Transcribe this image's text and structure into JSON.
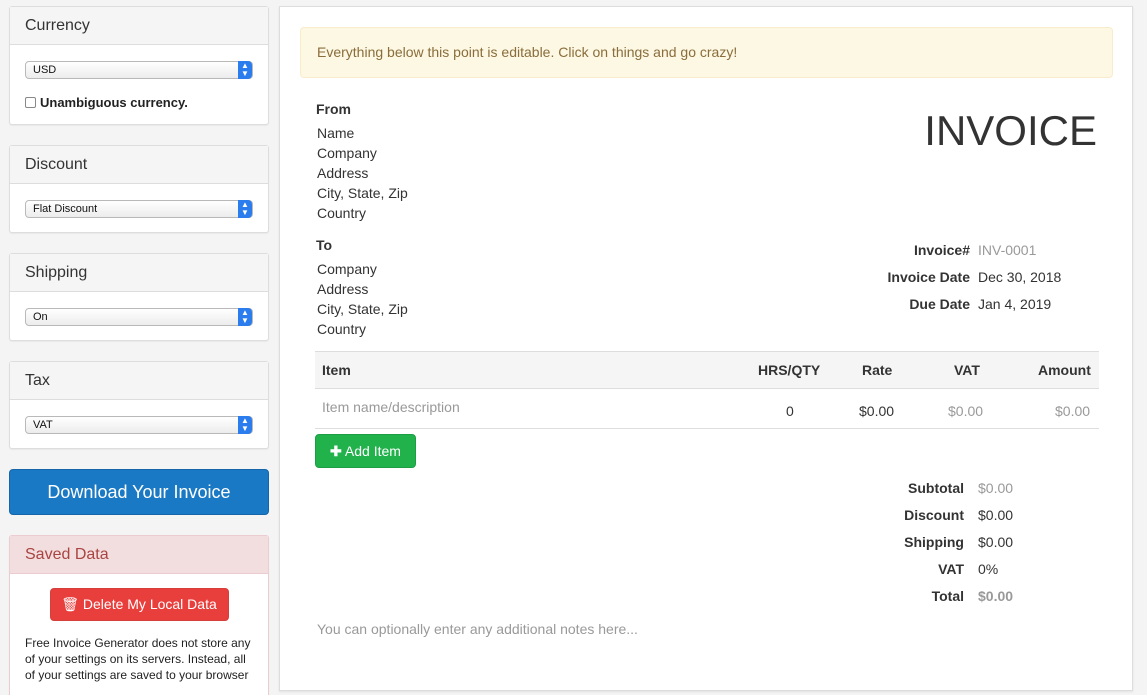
{
  "sidebar": {
    "currency": {
      "title": "Currency",
      "selected": "USD",
      "checkbox_label": "Unambiguous currency."
    },
    "discount": {
      "title": "Discount",
      "selected": "Flat Discount"
    },
    "shipping": {
      "title": "Shipping",
      "selected": "On"
    },
    "tax": {
      "title": "Tax",
      "selected": "VAT"
    },
    "download_label": "Download Your Invoice",
    "saved": {
      "title": "Saved Data",
      "delete_label": "Delete My Local Data",
      "text": "Free Invoice Generator does not store any of your settings on its servers. Instead, all of your settings are saved to your browser"
    }
  },
  "main": {
    "alert": "Everything below this point is editable. Click on things and go crazy!",
    "from": {
      "label": "From",
      "lines": [
        "Name",
        "Company",
        "Address",
        "City, State, Zip",
        "Country"
      ]
    },
    "to": {
      "label": "To",
      "lines": [
        "Company",
        "Address",
        "City, State, Zip",
        "Country"
      ]
    },
    "title": "INVOICE",
    "meta": {
      "invoice_no_label": "Invoice#",
      "invoice_no": "INV-0001",
      "date_label": "Invoice Date",
      "date": "Dec 30, 2018",
      "due_label": "Due Date",
      "due": "Jan 4, 2019"
    },
    "table": {
      "headers": {
        "item": "Item",
        "qty": "HRS/QTY",
        "rate": "Rate",
        "vat": "VAT",
        "amount": "Amount"
      },
      "row": {
        "item_placeholder": "Item name/description",
        "qty": "0",
        "rate": "$0.00",
        "vat": "$0.00",
        "amount": "$0.00"
      }
    },
    "add_item_label": "Add Item",
    "totals": {
      "subtotal_label": "Subtotal",
      "subtotal": "$0.00",
      "discount_label": "Discount",
      "discount": "$0.00",
      "shipping_label": "Shipping",
      "shipping": "$0.00",
      "vat_label": "VAT",
      "vat": "0%",
      "total_label": "Total",
      "total": "$0.00"
    },
    "notes_placeholder": "You can optionally enter any additional notes here..."
  },
  "colors": {
    "download_button": "#1a79c4",
    "delete_button": "#e83e3c",
    "add_button": "#22b24c",
    "alert_bg": "#fcf8e3",
    "alert_text": "#8a6d3b",
    "saved_heading": "#a94442"
  },
  "icons": {
    "add": "plus-icon",
    "delete": "trash-icon",
    "select": "chevron-updown-icon"
  }
}
